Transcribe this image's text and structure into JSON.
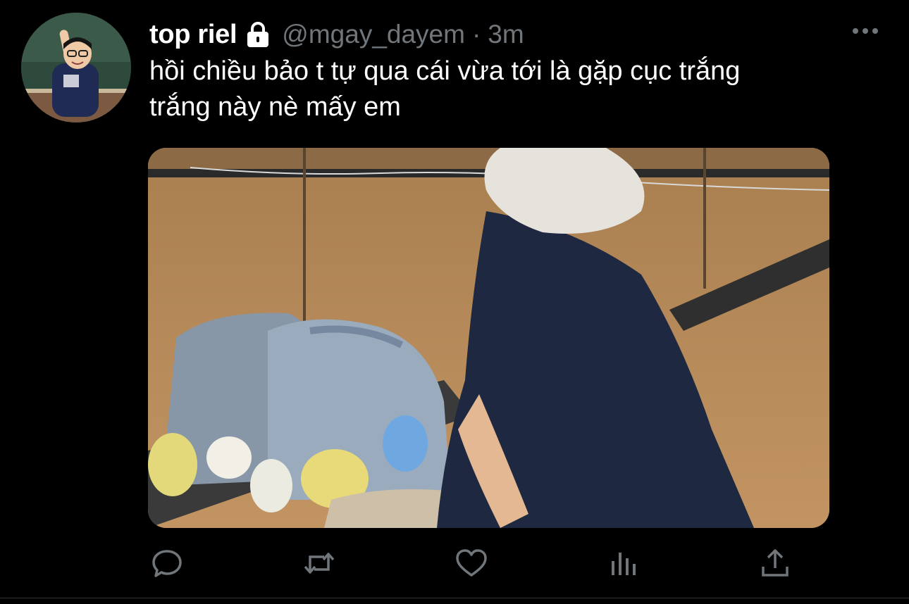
{
  "tweet": {
    "display_name": "top riel",
    "handle": "@mgay_dayem",
    "separator": "·",
    "time": "3m",
    "text_line1": "hồi chiều bảo t tự qua cái vừa tới là gặp cục trắng",
    "text_line2": "trắng này nè mấy em",
    "avatar": "profile-photo",
    "media": "photo-white-haired-person-with-backpacks-in-dance-studio"
  },
  "icons": {
    "lock": "lock-icon",
    "more": "more-icon",
    "reply": "reply-icon",
    "retweet": "retweet-icon",
    "like": "heart-icon",
    "analytics": "analytics-icon",
    "share": "share-icon"
  },
  "colors": {
    "background": "#000000",
    "text": "#ffffff",
    "secondary_text": "#71767b"
  }
}
